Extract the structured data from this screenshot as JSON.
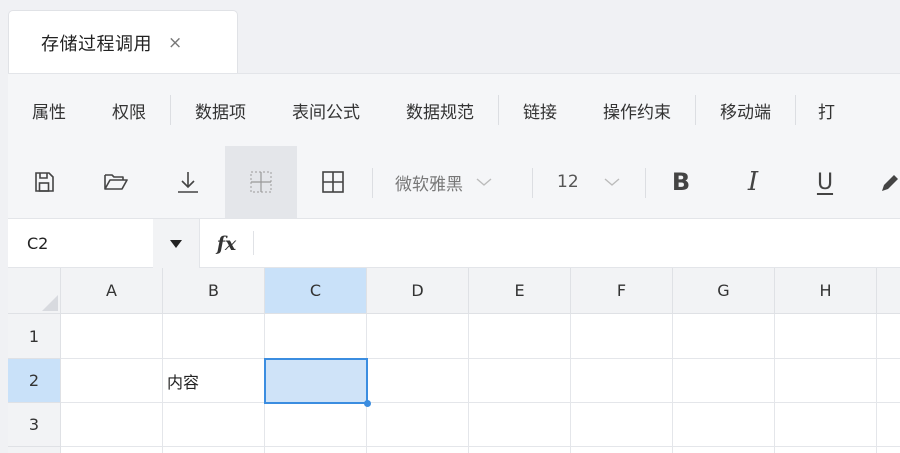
{
  "tabs": [
    {
      "label": "存储过程调用",
      "close": "×"
    }
  ],
  "menu": {
    "items": [
      "属性",
      "权限",
      "数据项",
      "表间公式",
      "数据规范",
      "链接",
      "操作约束",
      "移动端",
      "打"
    ]
  },
  "toolbar": {
    "buttons": [
      {
        "icon": "save-icon"
      },
      {
        "icon": "folder-open-icon"
      },
      {
        "icon": "download-icon"
      },
      {
        "icon": "inner-borders-icon",
        "active": true
      },
      {
        "icon": "all-borders-icon"
      }
    ],
    "font_family": "微软雅黑",
    "font_size": "12",
    "format_buttons": [
      {
        "icon": "bold-icon",
        "glyph": "B"
      },
      {
        "icon": "italic-icon",
        "glyph": "I"
      },
      {
        "icon": "underline-icon",
        "glyph": "U"
      },
      {
        "icon": "format-painter-icon"
      }
    ]
  },
  "formula_bar": {
    "cell_ref": "C2",
    "fx_label": "fx",
    "value": ""
  },
  "grid": {
    "columns": [
      "A",
      "B",
      "C",
      "D",
      "E",
      "F",
      "G",
      "H"
    ],
    "rows": [
      "1",
      "2",
      "3"
    ],
    "cells": {
      "B2": "内容"
    },
    "selected": "C2"
  },
  "colors": {
    "accent": "#3b8de0",
    "selection_fill": "#cfe3f8",
    "header_selected": "#c9e1f9"
  }
}
